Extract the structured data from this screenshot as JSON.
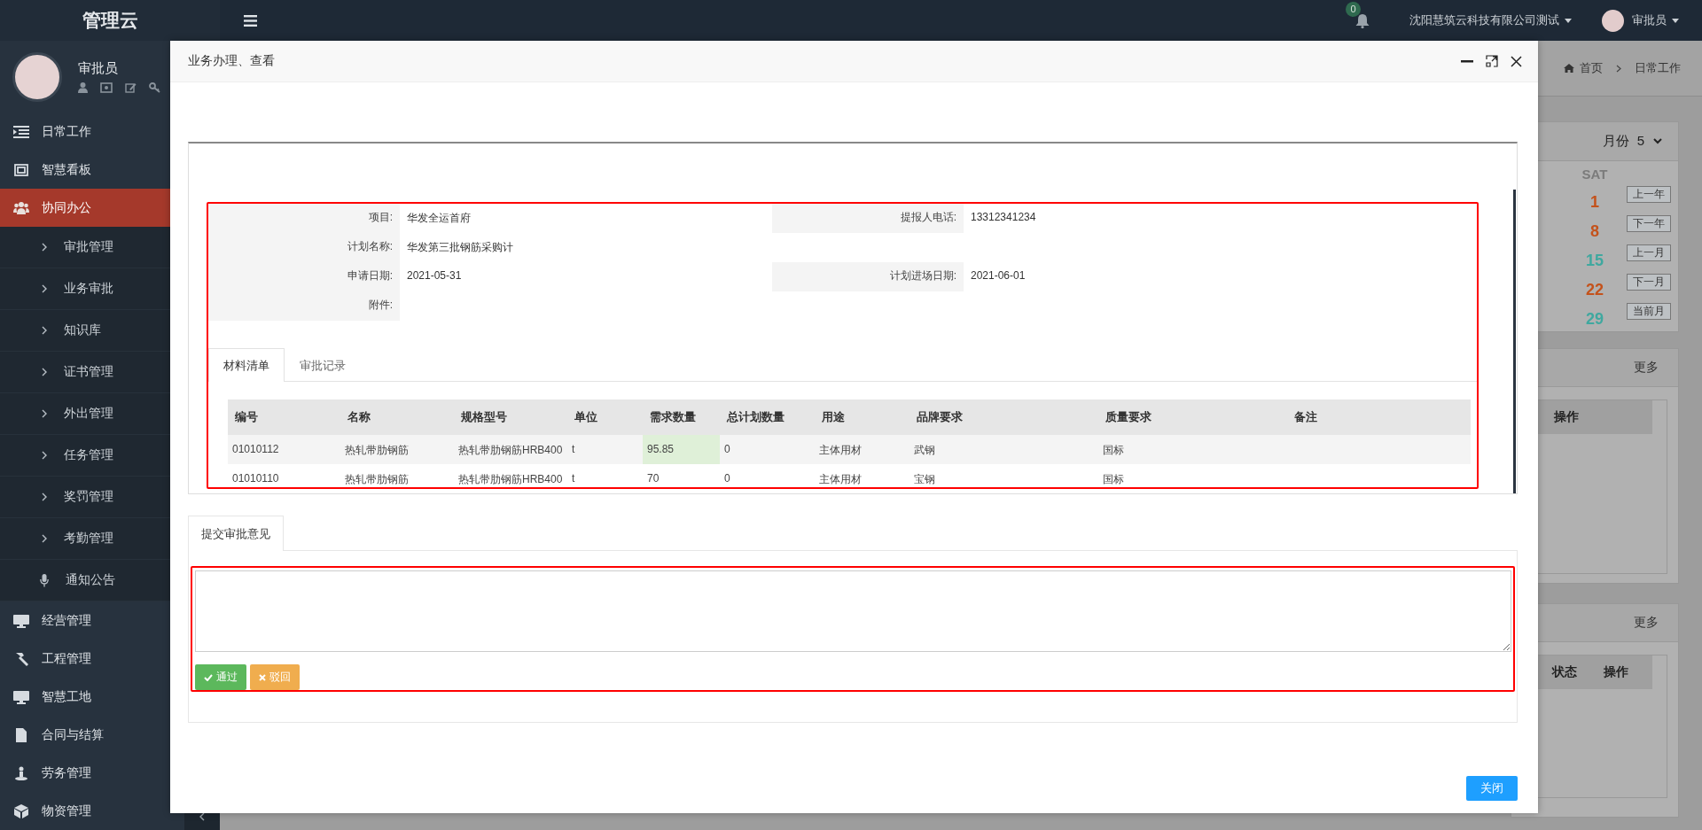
{
  "sidebar": {
    "logo": "管理云",
    "user": {
      "name": "审批员"
    },
    "menu": [
      {
        "label": "日常工作",
        "selected": false
      },
      {
        "label": "智慧看板",
        "selected": false
      },
      {
        "label": "协同办公",
        "selected": true,
        "expanded": true,
        "children": [
          {
            "label": "审批管理",
            "kind": "submenu"
          },
          {
            "label": "业务审批",
            "kind": "submenu"
          },
          {
            "label": "知识库",
            "kind": "submenu"
          },
          {
            "label": "证书管理",
            "kind": "submenu"
          },
          {
            "label": "外出管理",
            "kind": "submenu"
          },
          {
            "label": "任务管理",
            "kind": "submenu"
          },
          {
            "label": "奖罚管理",
            "kind": "submenu"
          },
          {
            "label": "考勤管理",
            "kind": "submenu"
          },
          {
            "label": "通知公告",
            "kind": "item"
          }
        ]
      },
      {
        "label": "经营管理",
        "selected": false
      },
      {
        "label": "工程管理",
        "selected": false
      },
      {
        "label": "智慧工地",
        "selected": false
      },
      {
        "label": "合同与结算",
        "selected": false
      },
      {
        "label": "劳务管理",
        "selected": false
      },
      {
        "label": "物资管理",
        "selected": false
      }
    ]
  },
  "topbar": {
    "notifications": "0",
    "company": "沈阳慧筑云科技有限公司测试",
    "user": "审批员"
  },
  "breadcrumb": [
    "首页",
    "日常工作"
  ],
  "calendar": {
    "month_label": "月份",
    "month": "5",
    "weekday": "SAT",
    "dates": [
      {
        "day": "1",
        "color": "#c4521b"
      },
      {
        "day": "8",
        "color": "#c4521b"
      },
      {
        "day": "15",
        "color": "#3fa89f"
      },
      {
        "day": "22",
        "color": "#c4521b"
      },
      {
        "day": "29",
        "color": "#3fa89f"
      }
    ],
    "buttons": [
      "上一年",
      "下一年",
      "上一月",
      "下一月",
      "当前月"
    ]
  },
  "panels": [
    {
      "more": "更多",
      "columns": [
        "操作"
      ]
    },
    {
      "more": "更多",
      "columns": [
        "状态",
        "操作"
      ]
    }
  ],
  "modal": {
    "title": "业务办理、查看",
    "fields": [
      {
        "left": {
          "label": "项目:",
          "value": "华发全运首府"
        },
        "right": {
          "label": "提报人电话:",
          "value": "13312341234"
        }
      },
      {
        "left": {
          "label": "计划名称:",
          "value": "华发第三批钢筋采购计"
        }
      },
      {
        "left": {
          "label": "申请日期:",
          "value": "2021-05-31"
        },
        "right": {
          "label": "计划进场日期:",
          "value": "2021-06-01"
        }
      },
      {
        "left": {
          "label": "附件:"
        }
      }
    ],
    "tabs": [
      {
        "label": "材料清单",
        "selected": true
      },
      {
        "label": "审批记录",
        "selected": false
      }
    ],
    "table": {
      "columns": [
        "编号",
        "名称",
        "规格型号",
        "单位",
        "需求数量",
        "总计划数量",
        "用途",
        "品牌要求",
        "质量要求",
        "备注"
      ],
      "rows": [
        {
          "cells": [
            {
              "text": "01010112",
              "highlighted": false
            },
            {
              "text": "热轧带肋钢筋",
              "highlighted": false
            },
            {
              "text": "热轧带肋钢筋HRB400",
              "highlighted": false
            },
            {
              "text": "t",
              "highlighted": false
            },
            {
              "text": "95.85",
              "highlighted": true
            },
            {
              "text": "0",
              "highlighted": false
            },
            {
              "text": "主体用材",
              "highlighted": false
            },
            {
              "text": "武钢",
              "highlighted": false
            },
            {
              "text": "国标",
              "highlighted": false
            }
          ]
        },
        {
          "cells": [
            {
              "text": "01010110",
              "highlighted": false
            },
            {
              "text": "热轧带肋钢筋",
              "highlighted": false
            },
            {
              "text": "热轧带肋钢筋HRB400",
              "highlighted": false
            },
            {
              "text": "t",
              "highlighted": false
            },
            {
              "text": "70",
              "highlighted": false
            },
            {
              "text": "0",
              "highlighted": false
            },
            {
              "text": "主体用材",
              "highlighted": false
            },
            {
              "text": "宝钢",
              "highlighted": false
            },
            {
              "text": "国标",
              "highlighted": false
            }
          ]
        }
      ]
    },
    "opinion": {
      "tab": "提交审批意见",
      "approve": "通过",
      "reject": "驳回"
    },
    "close": "关闭"
  }
}
